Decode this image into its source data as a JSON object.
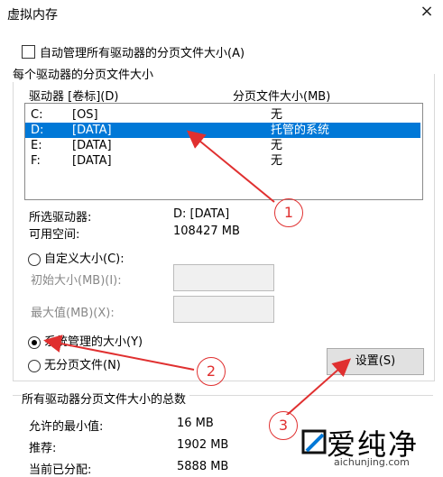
{
  "window": {
    "title": "虚拟内存",
    "close": "×"
  },
  "auto_manage": {
    "label": "自动管理所有驱动器的分页文件大小(A)",
    "checked": false
  },
  "drives_group": {
    "title": "每个驱动器的分页文件大小",
    "col_drive": "驱动器 [卷标](D)",
    "col_size": "分页文件大小(MB)",
    "rows": [
      {
        "drive": "C:",
        "label": "[OS]",
        "size": "无"
      },
      {
        "drive": "D:",
        "label": "[DATA]",
        "size": "托管的系统"
      },
      {
        "drive": "E:",
        "label": "[DATA]",
        "size": "无"
      },
      {
        "drive": "F:",
        "label": "[DATA]",
        "size": "无"
      }
    ],
    "selected_label": "所选驱动器:",
    "selected_value": "D:  [DATA]",
    "free_label": "可用空间:",
    "free_value": "108427 MB",
    "custom_label": "自定义大小(C):",
    "initial_label": "初始大小(MB)(I):",
    "max_label": "最大值(MB)(X):",
    "system_label": "系统管理的大小(Y)",
    "none_label": "无分页文件(N)",
    "set_button": "设置(S)"
  },
  "totals": {
    "title": "所有驱动器分页文件大小的总数",
    "min_label": "允许的最小值:",
    "min_value": "16 MB",
    "rec_label": "推荐:",
    "rec_value": "1902 MB",
    "cur_label": "当前已分配:",
    "cur_value": "5888 MB"
  },
  "annotations": {
    "m1": "1",
    "m2": "2",
    "m3": "3"
  },
  "watermark": {
    "text": "爱纯净",
    "url": "aichunjing.com"
  },
  "colors": {
    "selection": "#0078d7",
    "annotation": "#e03030"
  }
}
